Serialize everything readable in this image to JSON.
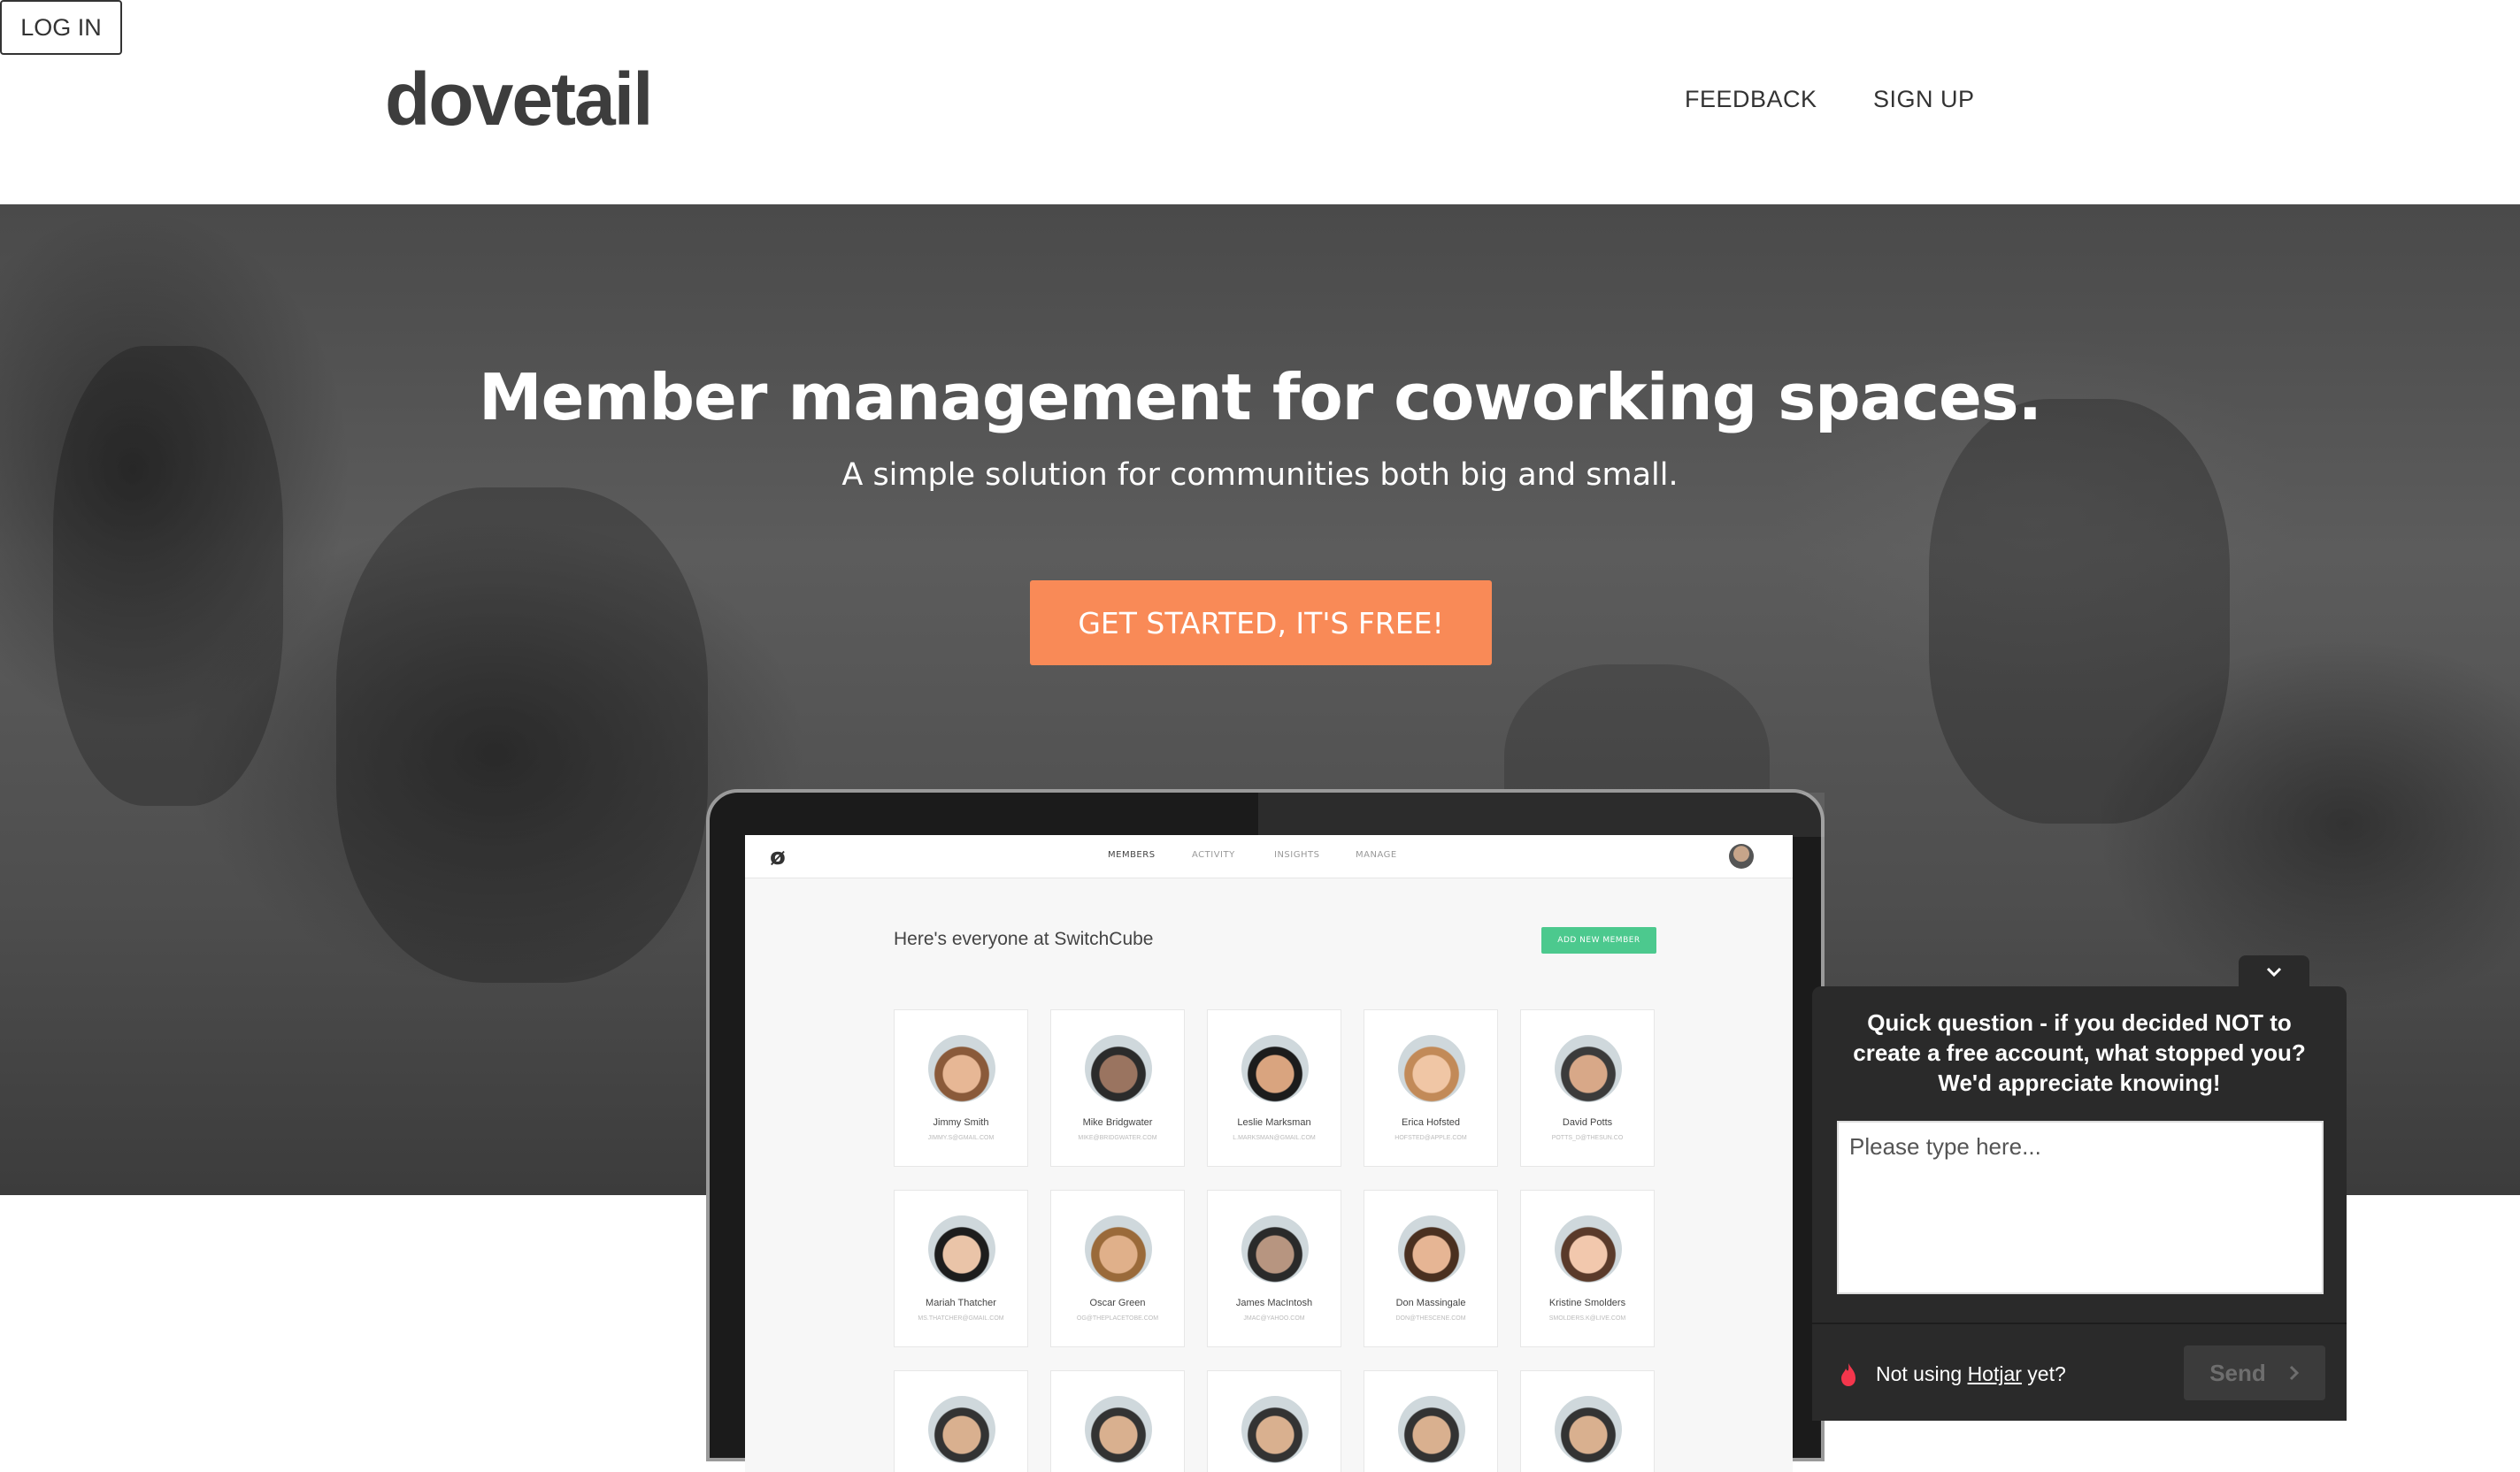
{
  "header": {
    "logo": "dovetail",
    "nav": {
      "feedback": "FEEDBACK",
      "signup": "SIGN UP",
      "login": "LOG IN"
    }
  },
  "hero": {
    "title": "Member management for coworking spaces.",
    "subtitle": "A simple solution for communities both big and small.",
    "cta": "GET STARTED, IT'S FREE!"
  },
  "app_preview": {
    "nav": [
      "MEMBERS",
      "ACTIVITY",
      "INSIGHTS",
      "MANAGE"
    ],
    "heading": "Here's everyone at SwitchCube",
    "add_member": "ADD NEW MEMBER",
    "members": [
      {
        "name": "Jimmy Smith",
        "email": "JIMMY.S@GMAIL.COM",
        "skin": "#e7b795",
        "hair": "#8a5a3a"
      },
      {
        "name": "Mike Bridgwater",
        "email": "MIKE@BRIDGWATER.COM",
        "skin": "#9a7460",
        "hair": "#2b2b2b"
      },
      {
        "name": "Leslie Marksman",
        "email": "L.MARKSMAN@GMAIL.COM",
        "skin": "#d9a47f",
        "hair": "#1c1c1c"
      },
      {
        "name": "Erica Hofsted",
        "email": "HOFSTED@APPLE.COM",
        "skin": "#f0c6a5",
        "hair": "#c28a58"
      },
      {
        "name": "David Potts",
        "email": "POTTS_D@THESUN.CO",
        "skin": "#d8a888",
        "hair": "#3b3b3b"
      },
      {
        "name": "Mariah Thatcher",
        "email": "MS.THATCHER@GMAIL.COM",
        "skin": "#eac4a8",
        "hair": "#1d1d1d"
      },
      {
        "name": "Oscar Green",
        "email": "OG@THEPLACETOBE.COM",
        "skin": "#e0b08a",
        "hair": "#9a6a3a"
      },
      {
        "name": "James MacIntosh",
        "email": "JMAC@YAHOO.COM",
        "skin": "#b79580",
        "hair": "#2a2a2a"
      },
      {
        "name": "Don Massingale",
        "email": "DON@THESCENE.COM",
        "skin": "#e6b594",
        "hair": "#4a3020"
      },
      {
        "name": "Kristine Smolders",
        "email": "SMOLDERS.K@LIVE.COM",
        "skin": "#f2c8ad",
        "hair": "#5a3a2a"
      }
    ]
  },
  "feedback_widget": {
    "question": "Quick question - if you decided NOT to create a free account, what stopped you? We'd appreciate knowing!",
    "placeholder": "Please type here...",
    "footer_prefix": "Not using ",
    "footer_link": "Hotjar",
    "footer_suffix": " yet?",
    "send": "Send",
    "toggle_icon": "chevron-down-icon"
  },
  "colors": {
    "cta": "#f98a57",
    "add_member": "#4cc98e",
    "widget_bg": "#2a2a2a"
  }
}
